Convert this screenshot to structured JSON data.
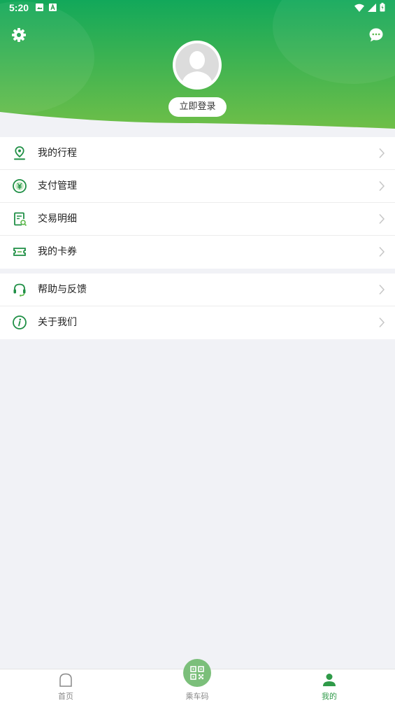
{
  "status_bar": {
    "time": "5:20"
  },
  "header": {
    "settings_icon": "gear-icon",
    "message_icon": "chat-bubble-icon",
    "login_label": "立即登录",
    "avatar_icon": "user-avatar-placeholder"
  },
  "menu": {
    "group1": [
      {
        "label": "我的行程",
        "icon": "location-pin-icon"
      },
      {
        "label": "支付管理",
        "icon": "yuan-coin-icon"
      },
      {
        "label": "交易明细",
        "icon": "receipt-search-icon"
      },
      {
        "label": "我的卡券",
        "icon": "ticket-coupon-icon"
      }
    ],
    "group2": [
      {
        "label": "帮助与反馈",
        "icon": "headset-icon"
      },
      {
        "label": "关于我们",
        "icon": "info-icon"
      }
    ]
  },
  "bottom_nav": {
    "items": [
      {
        "label": "首页",
        "icon": "home-icon",
        "active": false
      },
      {
        "label": "乘车码",
        "icon": "qr-code-icon",
        "active": false
      },
      {
        "label": "我的",
        "icon": "user-icon",
        "active": true
      }
    ]
  },
  "colors": {
    "brand_green": "#2f9a48",
    "header_green_dark": "#13a85a",
    "header_green_light": "#72c04a",
    "background": "#f1f2f6"
  }
}
